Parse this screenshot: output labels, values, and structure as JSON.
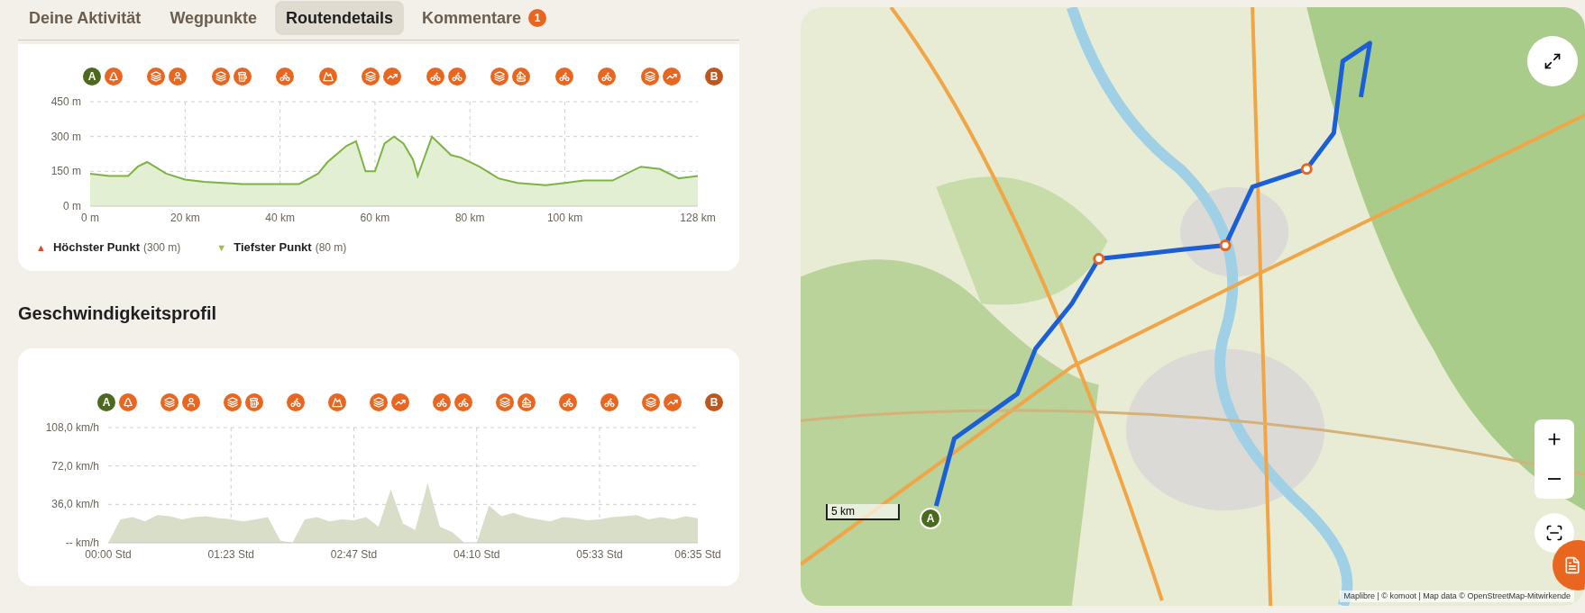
{
  "tabs": [
    {
      "label": "Deine Aktivität",
      "selected": false
    },
    {
      "label": "Wegpunkte",
      "selected": false
    },
    {
      "label": "Routendetails",
      "selected": true
    },
    {
      "label": "Kommentare",
      "selected": false,
      "badge": "1"
    }
  ],
  "elevation_profile": {
    "markers": [
      {
        "icons": [
          {
            "kind": "start",
            "label": "A"
          },
          {
            "kind": "tree"
          }
        ]
      },
      {
        "icons": [
          {
            "kind": "stack"
          },
          {
            "kind": "person"
          }
        ]
      },
      {
        "icons": [
          {
            "kind": "stack"
          },
          {
            "kind": "beer"
          }
        ]
      },
      {
        "icons": [
          {
            "kind": "bike"
          }
        ]
      },
      {
        "icons": [
          {
            "kind": "mountain"
          }
        ]
      },
      {
        "icons": [
          {
            "kind": "stack"
          },
          {
            "kind": "ramp"
          }
        ]
      },
      {
        "icons": [
          {
            "kind": "bike"
          },
          {
            "kind": "bike"
          }
        ]
      },
      {
        "icons": [
          {
            "kind": "stack"
          },
          {
            "kind": "boat"
          }
        ]
      },
      {
        "icons": [
          {
            "kind": "bike"
          }
        ]
      },
      {
        "icons": [
          {
            "kind": "bike"
          }
        ]
      },
      {
        "icons": [
          {
            "kind": "stack"
          },
          {
            "kind": "ramp"
          }
        ]
      },
      {
        "icons": [
          {
            "kind": "end",
            "label": "B"
          }
        ]
      }
    ],
    "chart_data": {
      "type": "area",
      "x": [
        0,
        4,
        8,
        10,
        12,
        16,
        20,
        24,
        28,
        32,
        36,
        40,
        44,
        48,
        50,
        54,
        56,
        58,
        60,
        62,
        64,
        66,
        68,
        69,
        72,
        76,
        78,
        82,
        86,
        90,
        96,
        100,
        104,
        110,
        116,
        120,
        124,
        128
      ],
      "grid": true,
      "series": [
        {
          "color": "#7cb342",
          "values": [
            140,
            130,
            130,
            170,
            190,
            140,
            115,
            105,
            100,
            95,
            95,
            95,
            95,
            140,
            190,
            260,
            280,
            150,
            150,
            270,
            300,
            270,
            200,
            130,
            300,
            220,
            210,
            170,
            120,
            100,
            90,
            100,
            110,
            110,
            170,
            160,
            120,
            130
          ]
        }
      ],
      "xlim": [
        0,
        128
      ],
      "ylim": [
        0,
        450
      ],
      "xticks": [
        {
          "value": 0,
          "label": "0 m"
        },
        {
          "value": 20,
          "label": "20 km"
        },
        {
          "value": 40,
          "label": "40 km"
        },
        {
          "value": 60,
          "label": "60 km"
        },
        {
          "value": 80,
          "label": "80 km"
        },
        {
          "value": 100,
          "label": "100 km"
        },
        {
          "value": 128,
          "label": "128 km"
        }
      ],
      "yticks": [
        {
          "value": 0,
          "label": "0 m"
        },
        {
          "value": 150,
          "label": "150 m"
        },
        {
          "value": 300,
          "label": "300 m"
        },
        {
          "value": 450,
          "label": "450 m"
        }
      ]
    },
    "legend": [
      {
        "kind": "highest",
        "marker": "▲",
        "label": "Höchster Punkt",
        "value": "(300 m)"
      },
      {
        "kind": "lowest",
        "marker": "▼",
        "label": "Tiefster Punkt",
        "value": "(80 m)"
      }
    ]
  },
  "speed_profile": {
    "title": "Geschwindigkeitsprofil",
    "markers": [
      {
        "icons": [
          {
            "kind": "start",
            "label": "A"
          },
          {
            "kind": "tree"
          }
        ]
      },
      {
        "icons": [
          {
            "kind": "stack"
          },
          {
            "kind": "person"
          }
        ]
      },
      {
        "icons": [
          {
            "kind": "stack"
          },
          {
            "kind": "beer"
          }
        ]
      },
      {
        "icons": [
          {
            "kind": "bike"
          }
        ]
      },
      {
        "icons": [
          {
            "kind": "mountain"
          }
        ]
      },
      {
        "icons": [
          {
            "kind": "stack"
          },
          {
            "kind": "ramp"
          }
        ]
      },
      {
        "icons": [
          {
            "kind": "bike"
          },
          {
            "kind": "bike"
          }
        ]
      },
      {
        "icons": [
          {
            "kind": "stack"
          },
          {
            "kind": "boat"
          }
        ]
      },
      {
        "icons": [
          {
            "kind": "bike"
          }
        ]
      },
      {
        "icons": [
          {
            "kind": "bike"
          }
        ]
      },
      {
        "icons": [
          {
            "kind": "stack"
          },
          {
            "kind": "ramp"
          }
        ]
      },
      {
        "icons": [
          {
            "kind": "end",
            "label": "B"
          }
        ]
      }
    ],
    "chart_data": {
      "type": "area",
      "categories": [
        "00:00 Std",
        null,
        null,
        null,
        null,
        null,
        null,
        null,
        null,
        null,
        "01:23 Std",
        null,
        null,
        null,
        null,
        null,
        null,
        null,
        null,
        null,
        "02:47 Std",
        null,
        null,
        null,
        null,
        null,
        null,
        null,
        null,
        null,
        "04:10 Std",
        null,
        null,
        null,
        null,
        null,
        null,
        null,
        null,
        null,
        "05:33 Std",
        null,
        null,
        null,
        null,
        null,
        null,
        null,
        "06:35 Std"
      ],
      "grid": true,
      "series": [
        {
          "color": "#d8dec8",
          "values": [
            0,
            22,
            24,
            20,
            26,
            25,
            22,
            24,
            25,
            23,
            22,
            20,
            22,
            24,
            2,
            0,
            22,
            24,
            20,
            22,
            21,
            24,
            15,
            50,
            18,
            12,
            56,
            15,
            10,
            0,
            0,
            35,
            25,
            28,
            24,
            22,
            20,
            24,
            23,
            21,
            22,
            24,
            25,
            26,
            22,
            24,
            22,
            25,
            23
          ]
        }
      ],
      "ylim": [
        0,
        108
      ],
      "yticks": [
        {
          "value": 0,
          "label": "-- km/h"
        },
        {
          "value": 36,
          "label": "36,0 km/h"
        },
        {
          "value": 72,
          "label": "72,0 km/h"
        },
        {
          "value": 108,
          "label": "108,0 km/h"
        }
      ]
    }
  },
  "map": {
    "kind": "picture",
    "start_marker": "A",
    "scale": "5 km",
    "attribution": "Maplibre | © komoot | Map data © OpenStreetMap-Mitwirkende"
  }
}
